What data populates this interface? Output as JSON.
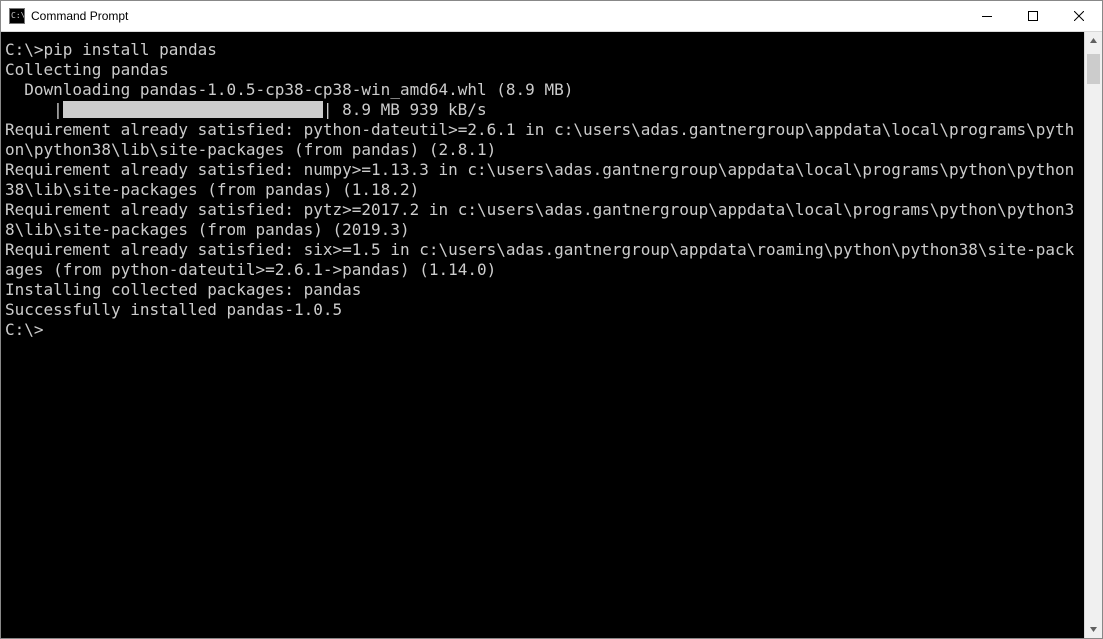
{
  "window": {
    "title": "Command Prompt"
  },
  "terminal": {
    "prompt1": "C:\\>",
    "command1": "pip install pandas",
    "lines": [
      "Collecting pandas",
      "  Downloading pandas-1.0.5-cp38-cp38-win_amd64.whl (8.9 MB)"
    ],
    "progress_prefix": "     |",
    "progress_suffix": "| 8.9 MB 939 kB/s",
    "lines_after": [
      "Requirement already satisfied: python-dateutil>=2.6.1 in c:\\users\\adas.gantnergroup\\appdata\\local\\programs\\python\\python38\\lib\\site-packages (from pandas) (2.8.1)",
      "Requirement already satisfied: numpy>=1.13.3 in c:\\users\\adas.gantnergroup\\appdata\\local\\programs\\python\\python38\\lib\\site-packages (from pandas) (1.18.2)",
      "Requirement already satisfied: pytz>=2017.2 in c:\\users\\adas.gantnergroup\\appdata\\local\\programs\\python\\python38\\lib\\site-packages (from pandas) (2019.3)",
      "Requirement already satisfied: six>=1.5 in c:\\users\\adas.gantnergroup\\appdata\\roaming\\python\\python38\\site-packages (from python-dateutil>=2.6.1->pandas) (1.14.0)",
      "Installing collected packages: pandas",
      "Successfully installed pandas-1.0.5",
      "",
      "C:\\>"
    ]
  }
}
